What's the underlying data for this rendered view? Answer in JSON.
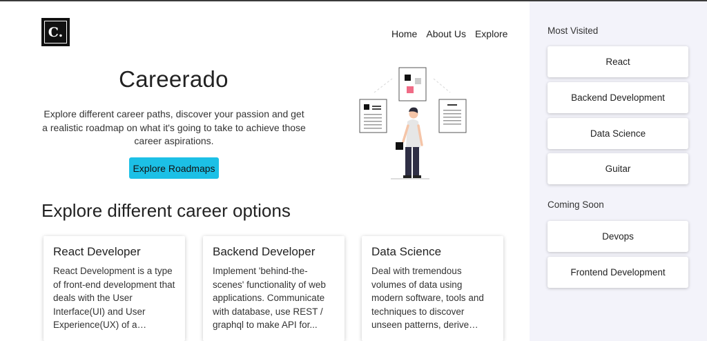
{
  "logo": {
    "text": "C."
  },
  "nav": [
    "Home",
    "About Us",
    "Explore"
  ],
  "hero": {
    "title": "Careerado",
    "description": "Explore different career paths, discover your passion and get a realistic roadmap on what it's going to take to achieve those career aspirations.",
    "cta_label": "Explore Roadmaps"
  },
  "section_title": "Explore different career options",
  "cards": [
    {
      "title": "React Developer",
      "description": "React Development is a type of front-end development that deals with the User Interface(UI) and User Experience(UX) of a website..."
    },
    {
      "title": "Backend Developer",
      "description": "Implement 'behind-the-scenes' functionality of web applications. Communicate with database, use REST / graphql to make API for..."
    },
    {
      "title": "Data Science",
      "description": "Deal with tremendous volumes of data using modern software, tools and techniques to discover unseen patterns, derive meaningful informati..."
    }
  ],
  "sidebar": {
    "most_visited_heading": "Most Visited",
    "most_visited": [
      "React",
      "Backend Development",
      "Data Science",
      "Guitar"
    ],
    "coming_soon_heading": "Coming Soon",
    "coming_soon": [
      "Devops",
      "Frontend Development"
    ]
  },
  "colors": {
    "accent": "#1cc0e6",
    "sidebar_bg": "#f3f3fa",
    "illustration_pink": "#f06b86"
  }
}
